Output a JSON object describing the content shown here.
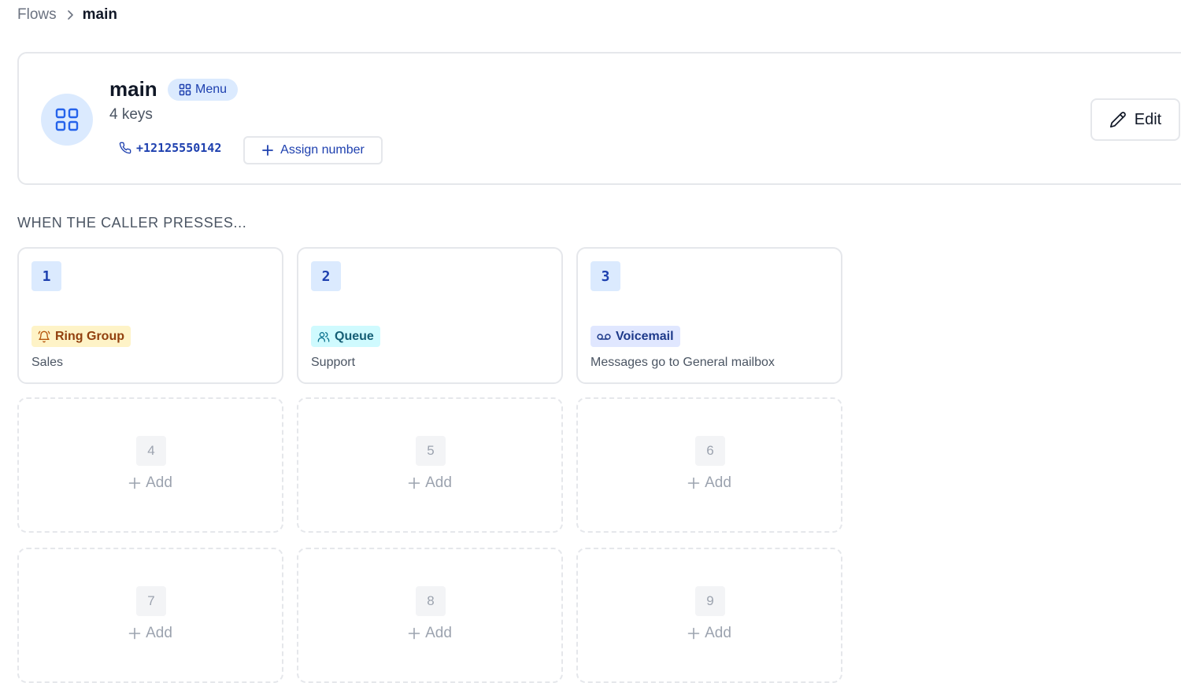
{
  "breadcrumb": {
    "parent": "Flows",
    "current": "main"
  },
  "flow": {
    "name": "main",
    "type_label": "Menu",
    "key_count": "4 keys",
    "phone": "+12125550142",
    "assign_label": "Assign number",
    "edit_label": "Edit"
  },
  "section": {
    "heading": "WHEN THE CALLER PRESSES..."
  },
  "keys": [
    {
      "number": "1",
      "dest": "Ring Group",
      "label": "Sales",
      "icon": "bell-icon",
      "bg": "#fef3c7",
      "fg": "#92400e"
    },
    {
      "number": "2",
      "dest": "Queue",
      "label": "Support",
      "icon": "users-icon",
      "bg": "#cffafe",
      "fg": "#155e75"
    },
    {
      "number": "3",
      "dest": "Voicemail",
      "label": "Messages go to General mailbox",
      "icon": "voicemail-icon",
      "bg": "#e0e7ff",
      "fg": "#1e3a8a"
    }
  ],
  "empty_keys": [
    {
      "number": "4",
      "add": "Add"
    },
    {
      "number": "5",
      "add": "Add"
    },
    {
      "number": "6",
      "add": "Add"
    },
    {
      "number": "7",
      "add": "Add"
    },
    {
      "number": "8",
      "add": "Add"
    },
    {
      "number": "9",
      "add": "Add"
    }
  ]
}
